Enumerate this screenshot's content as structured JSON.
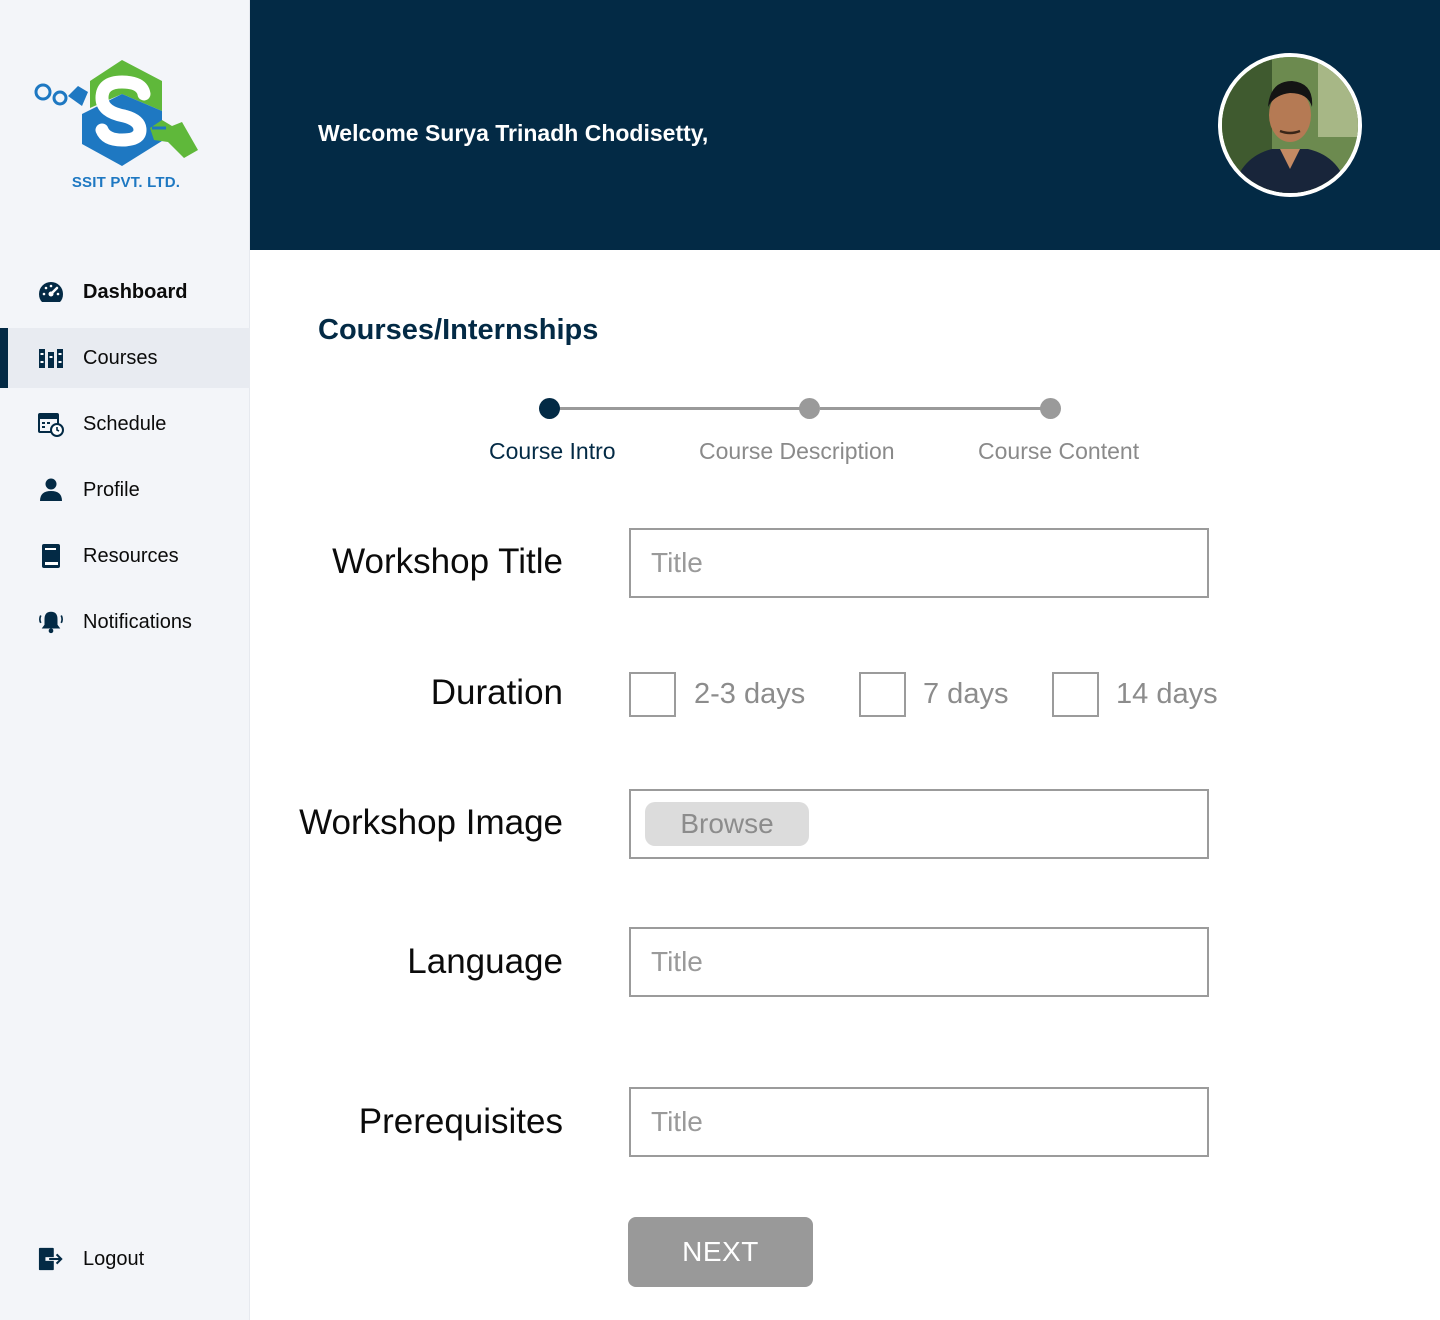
{
  "brand": {
    "name": "SSIT PVT. LTD.",
    "colors": {
      "primary": "#032a45",
      "logo_green": "#5fb83a",
      "logo_blue": "#1e78c2"
    }
  },
  "header": {
    "welcome": "Welcome Surya Trinadh Chodisetty,"
  },
  "sidebar": {
    "items": [
      {
        "label": "Dashboard",
        "icon": "speedometer-icon"
      },
      {
        "label": "Courses",
        "icon": "books-icon",
        "active": true
      },
      {
        "label": "Schedule",
        "icon": "calendar-clock-icon"
      },
      {
        "label": "Profile",
        "icon": "person-icon"
      },
      {
        "label": "Resources",
        "icon": "book-icon"
      },
      {
        "label": "Notifications",
        "icon": "bell-icon"
      }
    ],
    "logout": {
      "label": "Logout",
      "icon": "logout-icon"
    }
  },
  "main": {
    "title": "Courses/Internships",
    "steps": [
      {
        "label": "Course Intro",
        "active": true
      },
      {
        "label": "Course Description",
        "active": false
      },
      {
        "label": "Course Content",
        "active": false
      }
    ],
    "form": {
      "workshop_title": {
        "label": "Workshop Title",
        "placeholder": "Title",
        "value": ""
      },
      "duration": {
        "label": "Duration",
        "options": [
          {
            "label": "2-3 days",
            "checked": false
          },
          {
            "label": "7 days",
            "checked": false
          },
          {
            "label": "14 days",
            "checked": false
          }
        ]
      },
      "workshop_image": {
        "label": "Workshop Image",
        "button": "Browse"
      },
      "language": {
        "label": "Language",
        "placeholder": "Title",
        "value": ""
      },
      "prerequisites": {
        "label": "Prerequisites",
        "placeholder": "Title",
        "value": ""
      }
    },
    "next_label": "NEXT"
  }
}
